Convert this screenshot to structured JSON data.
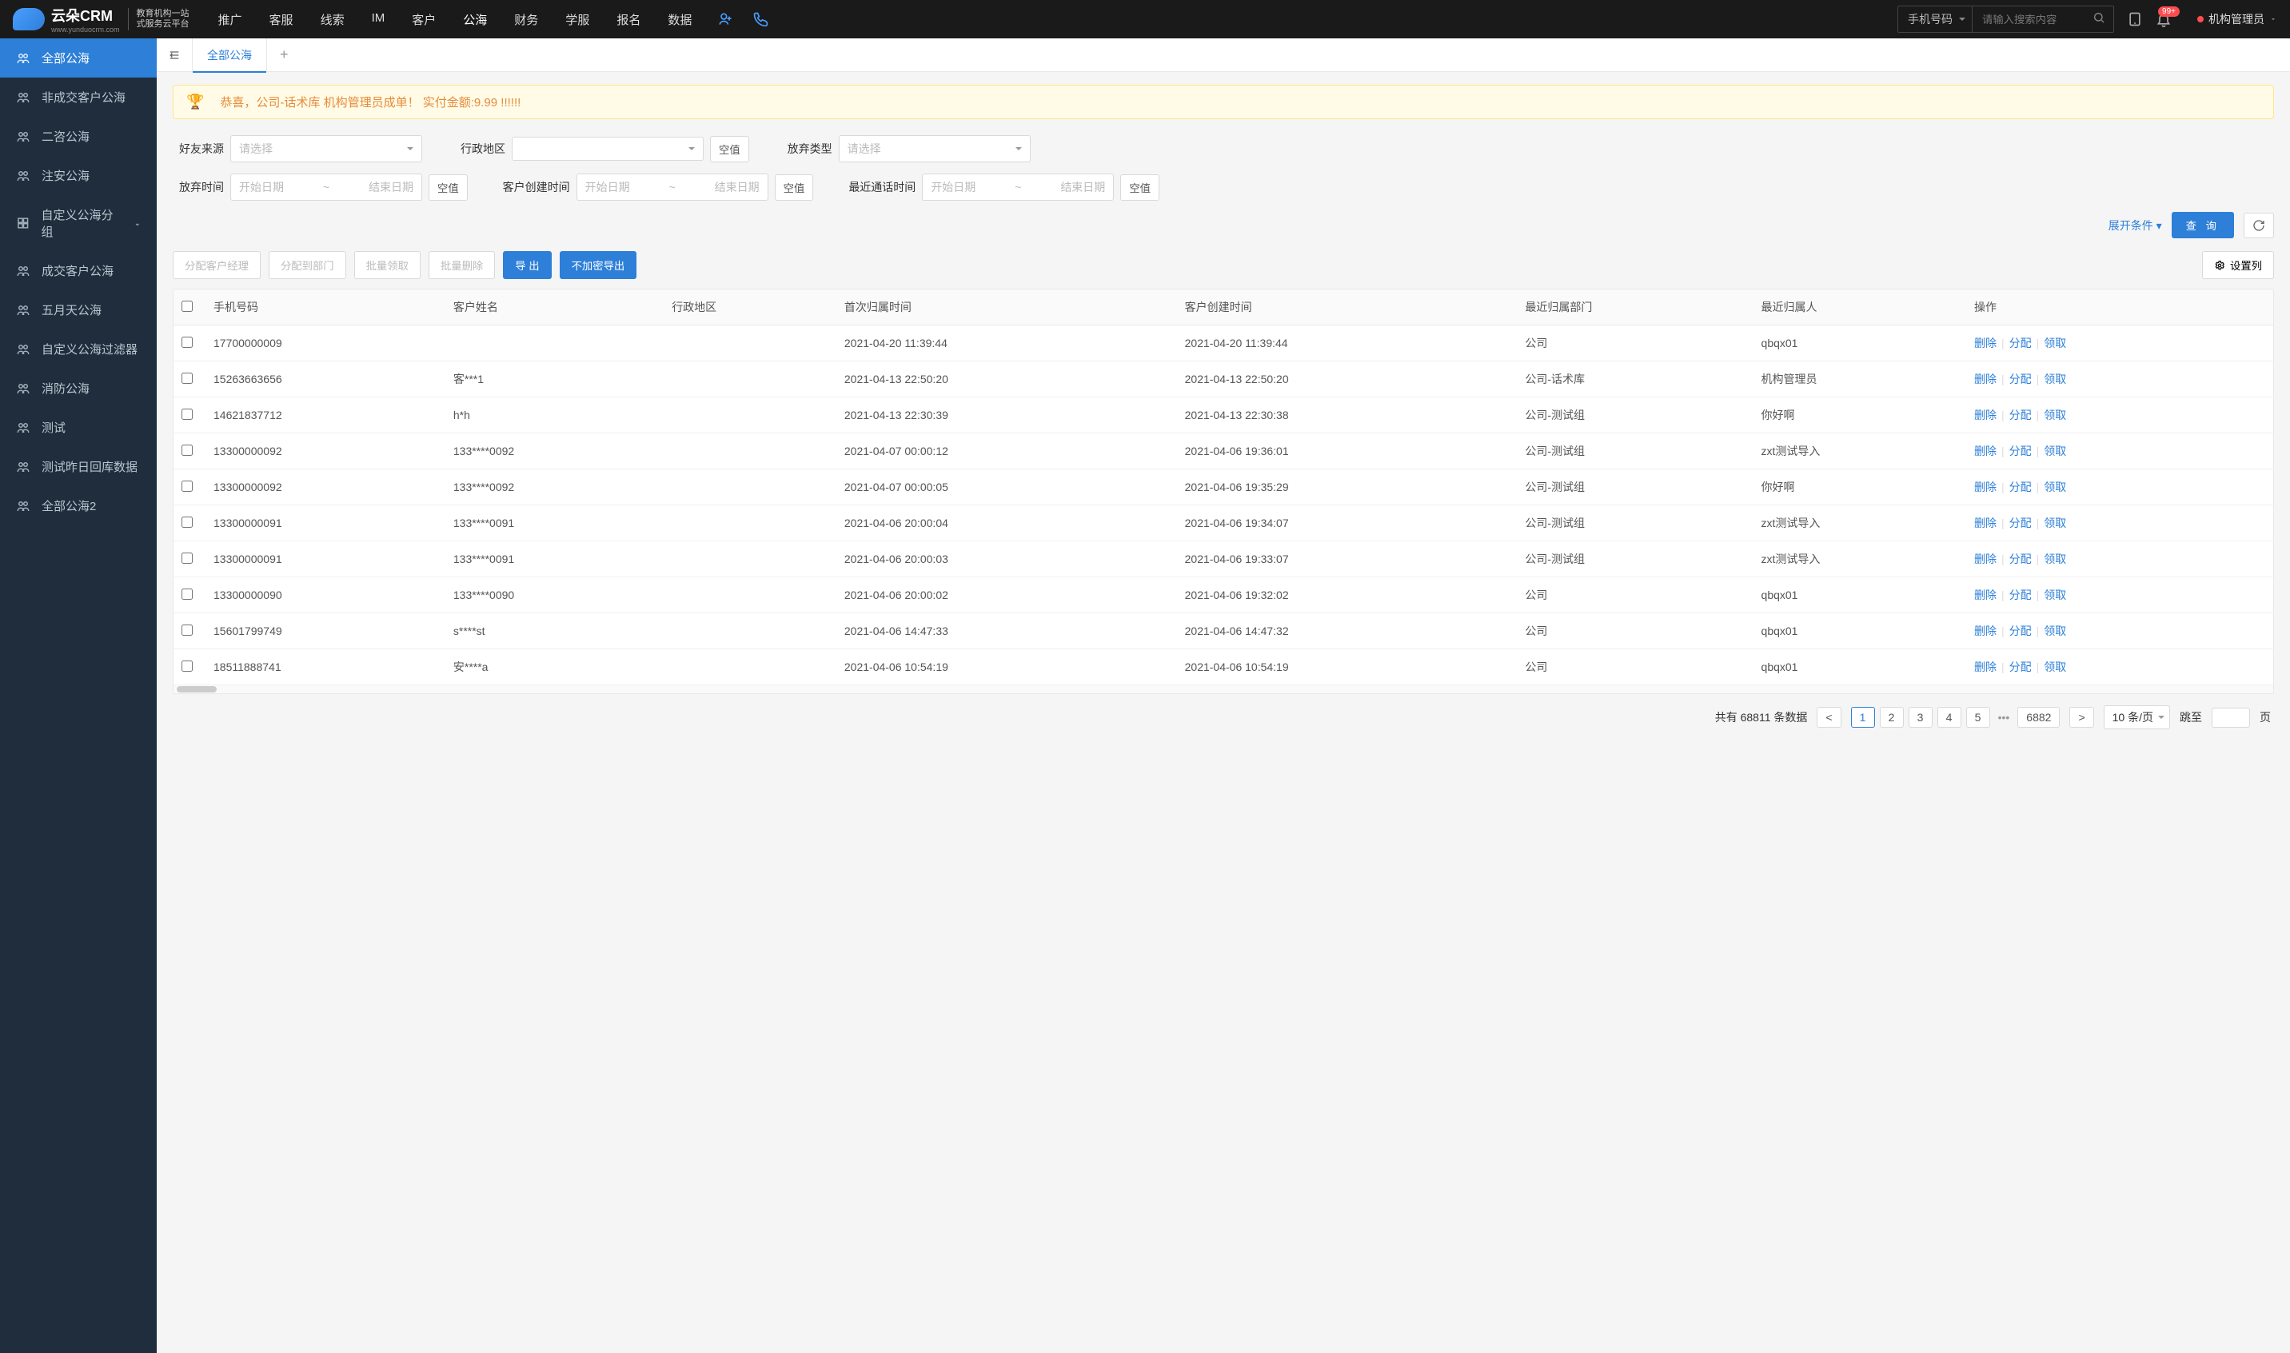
{
  "logo": {
    "brand": "云朵CRM",
    "subline1": "教育机构一站",
    "subline2": "式服务云平台"
  },
  "nav": {
    "items": [
      "推广",
      "客服",
      "线索",
      "IM",
      "客户",
      "公海",
      "财务",
      "学服",
      "报名",
      "数据"
    ],
    "activeIndex": 5
  },
  "search": {
    "type": "手机号码",
    "placeholder": "请输入搜索内容"
  },
  "header": {
    "badge": "99+",
    "user": "机构管理员"
  },
  "sidebar": {
    "items": [
      {
        "label": "全部公海",
        "icon": "users",
        "active": true
      },
      {
        "label": "非成交客户公海",
        "icon": "users"
      },
      {
        "label": "二咨公海",
        "icon": "users"
      },
      {
        "label": "注安公海",
        "icon": "users"
      },
      {
        "label": "自定义公海分组",
        "icon": "grid",
        "expandable": true
      },
      {
        "label": "成交客户公海",
        "icon": "users"
      },
      {
        "label": "五月天公海",
        "icon": "users"
      },
      {
        "label": "自定义公海过滤器",
        "icon": "users"
      },
      {
        "label": "消防公海",
        "icon": "users"
      },
      {
        "label": "测试",
        "icon": "users"
      },
      {
        "label": "测试昨日回库数据",
        "icon": "users"
      },
      {
        "label": "全部公海2",
        "icon": "users"
      }
    ]
  },
  "tabs": {
    "active": "全部公海"
  },
  "alert": "恭喜，公司-话术库  机构管理员成单！  实付金额:9.99 !!!!!!",
  "filters": {
    "placeholders": {
      "select": "请选择",
      "start": "开始日期",
      "end": "结束日期"
    },
    "nullBtn": "空值",
    "source": "好友来源",
    "region": "行政地区",
    "abandonType": "放弃类型",
    "abandonTime": "放弃时间",
    "createTime": "客户创建时间",
    "callTime": "最近通话时间",
    "expand": "展开条件",
    "query": "查 询"
  },
  "toolbar": {
    "assignManager": "分配客户经理",
    "assignDept": "分配到部门",
    "batchClaim": "批量领取",
    "batchDelete": "批量删除",
    "export": "导 出",
    "exportPlain": "不加密导出",
    "settings": "设置列"
  },
  "table": {
    "columns": [
      "手机号码",
      "客户姓名",
      "行政地区",
      "首次归属时间",
      "客户创建时间",
      "最近归属部门",
      "最近归属人",
      "操作"
    ],
    "actions": {
      "delete": "删除",
      "assign": "分配",
      "claim": "领取"
    },
    "rows": [
      {
        "phone": "17700000009",
        "name": "",
        "region": "",
        "firstTime": "2021-04-20 11:39:44",
        "createTime": "2021-04-20 11:39:44",
        "dept": "公司",
        "owner": "qbqx01"
      },
      {
        "phone": "15263663656",
        "name": "客***1",
        "region": "",
        "firstTime": "2021-04-13 22:50:20",
        "createTime": "2021-04-13 22:50:20",
        "dept": "公司-话术库",
        "owner": "机构管理员"
      },
      {
        "phone": "14621837712",
        "name": "h*h",
        "region": "",
        "firstTime": "2021-04-13 22:30:39",
        "createTime": "2021-04-13 22:30:38",
        "dept": "公司-测试组",
        "owner": "你好啊"
      },
      {
        "phone": "13300000092",
        "name": "133****0092",
        "region": "",
        "firstTime": "2021-04-07 00:00:12",
        "createTime": "2021-04-06 19:36:01",
        "dept": "公司-测试组",
        "owner": "zxt测试导入"
      },
      {
        "phone": "13300000092",
        "name": "133****0092",
        "region": "",
        "firstTime": "2021-04-07 00:00:05",
        "createTime": "2021-04-06 19:35:29",
        "dept": "公司-测试组",
        "owner": "你好啊"
      },
      {
        "phone": "13300000091",
        "name": "133****0091",
        "region": "",
        "firstTime": "2021-04-06 20:00:04",
        "createTime": "2021-04-06 19:34:07",
        "dept": "公司-测试组",
        "owner": "zxt测试导入"
      },
      {
        "phone": "13300000091",
        "name": "133****0091",
        "region": "",
        "firstTime": "2021-04-06 20:00:03",
        "createTime": "2021-04-06 19:33:07",
        "dept": "公司-测试组",
        "owner": "zxt测试导入"
      },
      {
        "phone": "13300000090",
        "name": "133****0090",
        "region": "",
        "firstTime": "2021-04-06 20:00:02",
        "createTime": "2021-04-06 19:32:02",
        "dept": "公司",
        "owner": "qbqx01"
      },
      {
        "phone": "15601799749",
        "name": "s****st",
        "region": "",
        "firstTime": "2021-04-06 14:47:33",
        "createTime": "2021-04-06 14:47:32",
        "dept": "公司",
        "owner": "qbqx01"
      },
      {
        "phone": "18511888741",
        "name": "安****a",
        "region": "",
        "firstTime": "2021-04-06 10:54:19",
        "createTime": "2021-04-06 10:54:19",
        "dept": "公司",
        "owner": "qbqx01"
      }
    ]
  },
  "pagination": {
    "totalPrefix": "共有",
    "total": "68811",
    "totalSuffix": "条数据",
    "pages": [
      "1",
      "2",
      "3",
      "4",
      "5"
    ],
    "lastPage": "6882",
    "pageSize": "10 条/页",
    "jumpLabel": "跳至",
    "pageUnit": "页"
  }
}
